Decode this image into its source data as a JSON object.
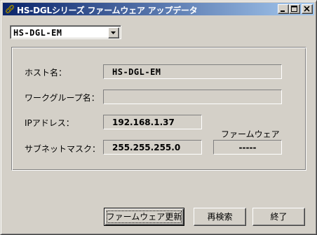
{
  "window": {
    "title": "HS-DGLシリーズ ファームウェア アップデータ",
    "icon": "link-chain-icon",
    "controls": [
      "minimize",
      "maximize",
      "close"
    ],
    "title_gradient": [
      "#0a246a",
      "#a6caf0"
    ],
    "face_color": "#d4d0c8"
  },
  "device_select": {
    "value": "HS-DGL-EM"
  },
  "info": {
    "host_label": "ホスト名：",
    "host_value": "HS-DGL-EM",
    "workgroup_label": "ワークグループ名：",
    "workgroup_value": "",
    "ip_label": "IPアドレス：",
    "ip_value": "192.168.1.37",
    "subnet_label": "サブネットマスク：",
    "subnet_value": "255.255.255.0",
    "firmware_label": "ファームウェア",
    "firmware_value": "-----"
  },
  "buttons": {
    "update": "ファームウェア更新",
    "rescan": "再検索",
    "exit": "終了"
  }
}
